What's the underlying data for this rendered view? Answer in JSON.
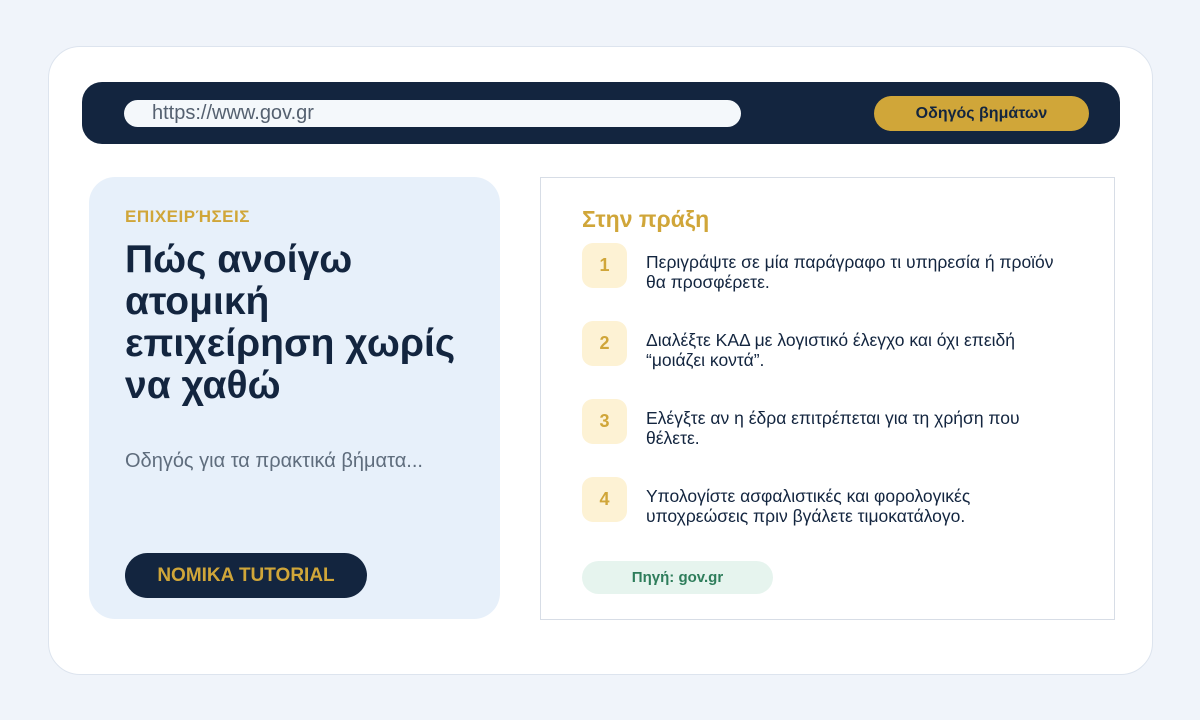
{
  "browser": {
    "url": "https://www.gov.gr",
    "guide_button": "Οδηγός βημάτων"
  },
  "hero": {
    "category": "ΕΠΙΧΕΙΡΉΣΕΙΣ",
    "title": "Πώς ανοίγω ατομική επιχείρηση χωρίς να χαθώ",
    "subtitle": "Οδηγός για τα πρακτικά βήματα...",
    "cta_label": "NOMIKA TUTORIAL"
  },
  "steps_panel": {
    "heading": "Στην πράξη",
    "steps": [
      {
        "num": "1",
        "text": "Περιγράψτε σε μία παράγραφο τι υπηρεσία ή προϊόν θα προσφέρετε."
      },
      {
        "num": "2",
        "text": "Διαλέξτε ΚΑΔ με λογιστικό έλεγχο και όχι επειδή “μοιάζει κοντά”."
      },
      {
        "num": "3",
        "text": "Ελέγξτε αν η έδρα επιτρέπεται για τη χρήση που θέλετε."
      },
      {
        "num": "4",
        "text": "Υπολογίστε ασφαλιστικές και φορολογικές υποχρεώσεις πριν βγάλετε τιμοκατάλογο."
      }
    ],
    "source": "Πηγή: gov.gr"
  },
  "colors": {
    "navy": "#13253f",
    "gold": "#d0a639",
    "hero_bg": "#e7f0fa",
    "source_green": "#2e7d5b"
  }
}
